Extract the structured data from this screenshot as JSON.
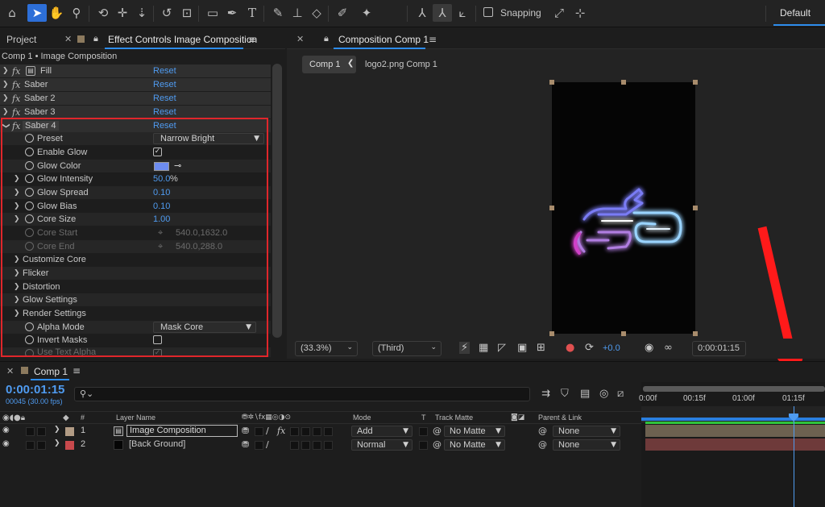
{
  "toolbar": {
    "tools": [
      "home-icon",
      "selection-icon",
      "hand-icon",
      "zoom-icon",
      "orbit-icon",
      "pan-icon",
      "dolly-icon",
      "rotate-icon",
      "anchor-icon",
      "rectangle-icon",
      "pen-icon",
      "type-icon",
      "brush-icon",
      "clone-stamp-icon",
      "eraser-icon",
      "roto-brush-icon",
      "puppet-pin-icon"
    ],
    "snapping_label": "Snapping",
    "workspace": "Default"
  },
  "left_panel": {
    "tab_project": "Project",
    "tab_effect_controls": "Effect Controls Image Composition",
    "breadcrumb": "Comp 1 • Image Composition",
    "effects": [
      {
        "name": "Fill",
        "reset": "Reset"
      },
      {
        "name": "Saber",
        "reset": "Reset"
      },
      {
        "name": "Saber 2",
        "reset": "Reset"
      },
      {
        "name": "Saber 3",
        "reset": "Reset"
      },
      {
        "name": "Saber 4",
        "reset": "Reset"
      }
    ],
    "props": {
      "preset_label": "Preset",
      "preset_value": "Narrow Bright",
      "enable_glow_label": "Enable Glow",
      "glow_color_label": "Glow Color",
      "glow_color": "#6d8cf0",
      "glow_intensity_label": "Glow Intensity",
      "glow_intensity_value": "50.0",
      "glow_intensity_unit": "%",
      "glow_spread_label": "Glow Spread",
      "glow_spread_value": "0.10",
      "glow_bias_label": "Glow Bias",
      "glow_bias_value": "0.10",
      "core_size_label": "Core Size",
      "core_size_value": "1.00",
      "core_start_label": "Core Start",
      "core_start_value": "540.0,1632.0",
      "core_end_label": "Core End",
      "core_end_value": "540.0,288.0",
      "customize_core": "Customize Core",
      "flicker": "Flicker",
      "distortion": "Distortion",
      "glow_settings": "Glow Settings",
      "render_settings": "Render Settings",
      "alpha_mode_label": "Alpha Mode",
      "alpha_mode_value": "Mask Core",
      "invert_masks_label": "Invert Masks",
      "use_text_alpha_label": "Use Text Alpha"
    }
  },
  "comp_panel": {
    "tab": "Composition Comp 1",
    "breadcrumb_active": "Comp 1",
    "breadcrumb_next": "logo2.png Comp 1",
    "zoom": "(33.3%)",
    "resolution": "(Third)",
    "exposure": "+0.0",
    "timecode": "0:00:01:15"
  },
  "timeline": {
    "tab": "Comp 1",
    "timecode": "0:00:01:15",
    "frames": "00045 (30.00 fps)",
    "headers": {
      "num": "#",
      "layer_name": "Layer Name",
      "mode": "Mode",
      "t": "T",
      "track_matte": "Track Matte",
      "parent": "Parent & Link"
    },
    "layers": [
      {
        "num": "1",
        "name": "Image Composition",
        "mode": "Add",
        "matte": "No Matte",
        "parent": "None",
        "color": "#b29c85",
        "bar_color": "#6d6150"
      },
      {
        "num": "2",
        "name": "[Back Ground]",
        "mode": "Normal",
        "matte": "No Matte",
        "parent": "None",
        "color": "#c8494c",
        "bar_color": "#6e3a3a"
      }
    ],
    "ruler": [
      "0:00f",
      "00:15f",
      "01:00f",
      "01:15f"
    ]
  }
}
